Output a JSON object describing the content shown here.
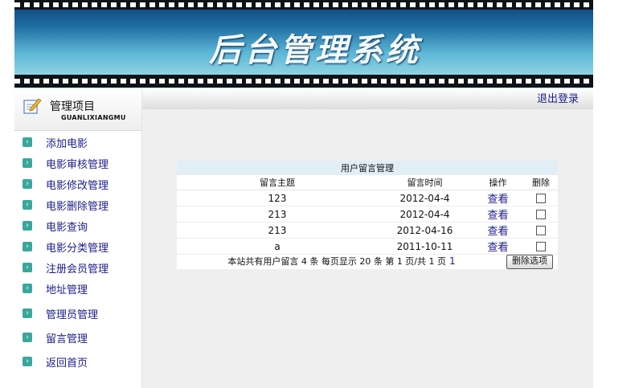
{
  "header": {
    "title": "后台管理系统"
  },
  "sidebar": {
    "title": "管理项目",
    "subtitle": "GUANLIXIANGMU",
    "items": [
      {
        "label": "添加电影"
      },
      {
        "label": "电影审核管理"
      },
      {
        "label": "电影修改管理"
      },
      {
        "label": "电影删除管理"
      },
      {
        "label": "电影查询"
      },
      {
        "label": "电影分类管理"
      },
      {
        "label": "注册会员管理"
      },
      {
        "label": "地址管理"
      },
      {
        "label": "管理员管理"
      },
      {
        "label": "留言管理"
      },
      {
        "label": "返回首页"
      }
    ]
  },
  "topbar": {
    "logout": "退出登录"
  },
  "table": {
    "title": "用户留言管理",
    "columns": [
      "留言主题",
      "留言时间",
      "操作",
      "删除"
    ],
    "rows": [
      {
        "subject": "123",
        "time": "2012-04-4",
        "action": "查看"
      },
      {
        "subject": "213",
        "time": "2012-04-4",
        "action": "查看"
      },
      {
        "subject": "213",
        "time": "2012-04-16",
        "action": "查看"
      },
      {
        "subject": "a",
        "time": "2011-10-11",
        "action": "查看"
      }
    ],
    "footer": {
      "summary": "本站共有用户留言 4 条 每页显示 20 条 第 1 页/共 1 页",
      "page_link": "1",
      "delete_button": "删除选项"
    }
  },
  "colors": {
    "menu_text": "#1c1c8a",
    "bullet": "#3aa79c",
    "banner_top": "#0b3d73",
    "banner_bottom": "#b9e8ef"
  }
}
